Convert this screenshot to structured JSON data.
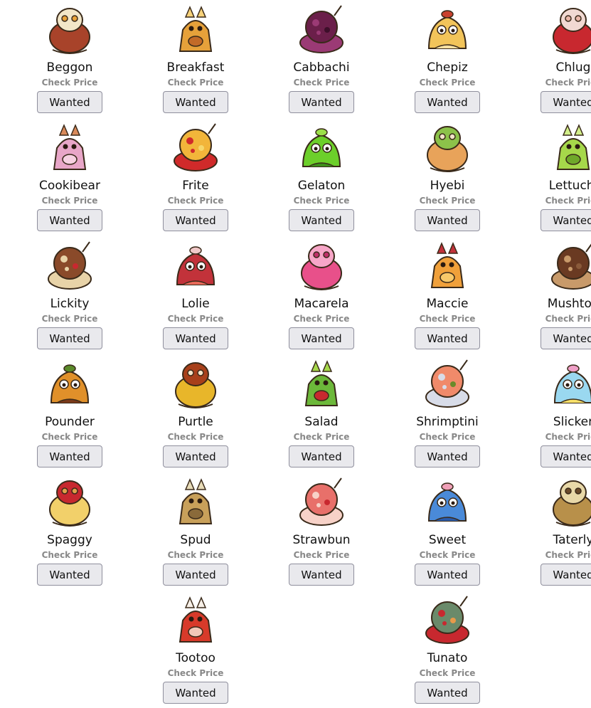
{
  "colors": {
    "button_bg": "#e9e9ed",
    "button_border": "#8f8f9d",
    "check_price_text": "#888888"
  },
  "grid": {
    "pets": [
      {
        "name": "Beggon",
        "check_price": "Check Price",
        "button": "Wanted",
        "icon": "bacon-egg-creature-icon",
        "colors": [
          "#a8432a",
          "#f2e6c8",
          "#e8a23a"
        ]
      },
      {
        "name": "Breakfast",
        "check_price": "Check Price",
        "button": "Wanted",
        "icon": "toast-fox-icon",
        "colors": [
          "#e6a13a",
          "#f7d27a",
          "#c26a28"
        ]
      },
      {
        "name": "Cabbachi",
        "check_price": "Check Price",
        "button": "Wanted",
        "icon": "purple-cabbage-icon",
        "colors": [
          "#6b1f4a",
          "#9b3a75",
          "#3d0f2a"
        ]
      },
      {
        "name": "Chepiz",
        "check_price": "Check Price",
        "button": "Wanted",
        "icon": "pizza-creature-icon",
        "colors": [
          "#f2c45a",
          "#c9412f",
          "#f7e0a0"
        ]
      },
      {
        "name": "Chlug",
        "check_price": "Check Price",
        "button": "Wanted",
        "icon": "cherry-slug-icon",
        "colors": [
          "#c8282f",
          "#f1d9d2",
          "#e9b6a8"
        ]
      },
      {
        "name": "Cookibear",
        "check_price": "Check Price",
        "button": "Wanted",
        "icon": "cookie-bear-icon",
        "colors": [
          "#e8a6c8",
          "#d98a5a",
          "#f6d1e2"
        ]
      },
      {
        "name": "Frite",
        "check_price": "Check Price",
        "button": "Wanted",
        "icon": "fries-creature-icon",
        "colors": [
          "#f2b53a",
          "#d02a2a",
          "#f7d76a"
        ]
      },
      {
        "name": "Gelaton",
        "check_price": "Check Price",
        "button": "Wanted",
        "icon": "green-jelly-bear-icon",
        "colors": [
          "#6ccf2a",
          "#9be04a",
          "#3e8e1a"
        ]
      },
      {
        "name": "Hyebi",
        "check_price": "Check Price",
        "button": "Wanted",
        "icon": "shrimp-hyena-icon",
        "colors": [
          "#e8a35a",
          "#8cc24a",
          "#f1e3c8"
        ]
      },
      {
        "name": "Lettuchi",
        "check_price": "Check Price",
        "button": "Wanted",
        "icon": "lettuce-sprout-icon",
        "colors": [
          "#a6d84a",
          "#d2ef8a",
          "#6fa82a"
        ]
      },
      {
        "name": "Lickity",
        "check_price": "Check Price",
        "button": "Wanted",
        "icon": "chocolate-cake-icon",
        "colors": [
          "#8a4a2a",
          "#e8d3a8",
          "#c8282f"
        ]
      },
      {
        "name": "Lolie",
        "check_price": "Check Price",
        "button": "Wanted",
        "icon": "lollipop-bear-icon",
        "colors": [
          "#c2323a",
          "#f1c8c8",
          "#e86a5a"
        ]
      },
      {
        "name": "Macarela",
        "check_price": "Check Price",
        "button": "Wanted",
        "icon": "macaron-icon",
        "colors": [
          "#e8508a",
          "#f7a6c8",
          "#c0306a"
        ]
      },
      {
        "name": "Maccie",
        "check_price": "Check Price",
        "button": "Wanted",
        "icon": "macaroon-burger-icon",
        "colors": [
          "#f0a03a",
          "#c2323a",
          "#f7c86a"
        ]
      },
      {
        "name": "Mushtoo",
        "check_price": "Check Price",
        "button": "Wanted",
        "icon": "brown-mushroom-icon",
        "colors": [
          "#6a3a22",
          "#c89a6a",
          "#8a5a3a"
        ]
      },
      {
        "name": "Pounder",
        "check_price": "Check Price",
        "button": "Wanted",
        "icon": "burger-monster-icon",
        "colors": [
          "#e0902a",
          "#5a8a2a",
          "#7a3a1a"
        ]
      },
      {
        "name": "Purtle",
        "check_price": "Check Price",
        "button": "Wanted",
        "icon": "pudding-turtle-icon",
        "colors": [
          "#e8b62a",
          "#a8401a",
          "#f7e6c8"
        ]
      },
      {
        "name": "Salad",
        "check_price": "Check Price",
        "button": "Wanted",
        "icon": "leaf-salad-creature-icon",
        "colors": [
          "#6cb83a",
          "#a6d84a",
          "#c8282f"
        ]
      },
      {
        "name": "Shrimptini",
        "check_price": "Check Price",
        "button": "Wanted",
        "icon": "shrimp-cocktail-icon",
        "colors": [
          "#f08a6a",
          "#d8dce8",
          "#6a8a2a"
        ]
      },
      {
        "name": "Slicker",
        "check_price": "Check Price",
        "button": "Wanted",
        "icon": "rainbow-candy-snail-icon",
        "colors": [
          "#9ad8f0",
          "#f0a0c8",
          "#f7e06a"
        ]
      },
      {
        "name": "Spaggy",
        "check_price": "Check Price",
        "button": "Wanted",
        "icon": "spaghetti-creature-icon",
        "colors": [
          "#f2d06a",
          "#c8282f",
          "#e0a04a"
        ]
      },
      {
        "name": "Spud",
        "check_price": "Check Price",
        "button": "Wanted",
        "icon": "potato-rabbit-icon",
        "colors": [
          "#c8a05a",
          "#e8dcb8",
          "#8a6a3a"
        ]
      },
      {
        "name": "Strawbun",
        "check_price": "Check Price",
        "button": "Wanted",
        "icon": "strawberry-bunny-icon",
        "colors": [
          "#e8706a",
          "#f7d2c8",
          "#c8282f"
        ]
      },
      {
        "name": "Sweet",
        "check_price": "Check Price",
        "button": "Wanted",
        "icon": "candy-wrapper-creature-icon",
        "colors": [
          "#4a8ad8",
          "#f0a0b8",
          "#2a5aa8"
        ]
      },
      {
        "name": "Taterly",
        "check_price": "Check Price",
        "button": "Wanted",
        "icon": "potato-bug-icon",
        "colors": [
          "#b8904a",
          "#e8d8a8",
          "#6a4a2a"
        ]
      },
      {
        "name": "Tootoo",
        "check_price": "Check Price",
        "button": "Wanted",
        "icon": "red-spotted-mushroom-icon",
        "colors": [
          "#d83a2a",
          "#f7f0e8",
          "#f2c8b8"
        ]
      },
      {
        "name": "Tunato",
        "check_price": "Check Price",
        "button": "Wanted",
        "icon": "tuna-can-creature-icon",
        "colors": [
          "#6a8a6a",
          "#c8282f",
          "#e89a4a"
        ]
      }
    ]
  }
}
